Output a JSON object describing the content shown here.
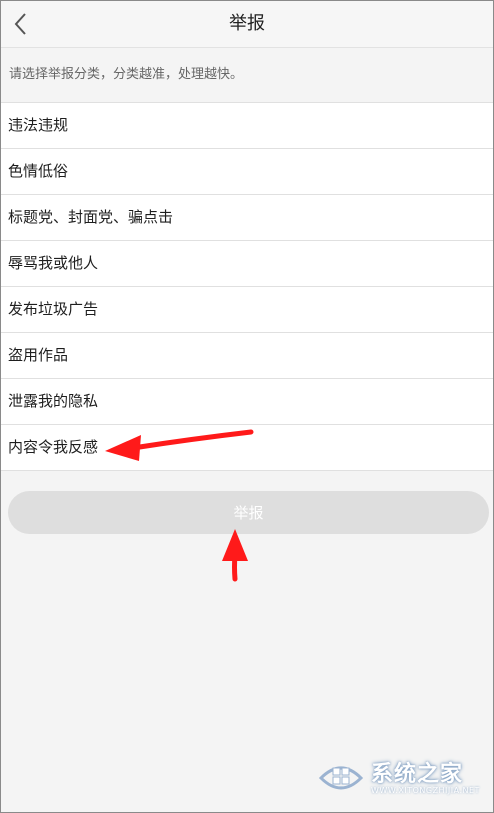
{
  "header": {
    "back_icon": "chevron-left-icon",
    "title": "举报"
  },
  "hint": "请选择举报分类，分类越准，处理越快。",
  "categories": [
    "违法违规",
    "色情低俗",
    "标题党、封面党、骗点击",
    "辱骂我或他人",
    "发布垃圾广告",
    "盗用作品",
    "泄露我的隐私",
    "内容令我反感"
  ],
  "submit_label": "举报",
  "watermark": {
    "brand": "系统之家",
    "url": "WWW.XITONGZHIJIA.NET"
  },
  "colors": {
    "annotation_arrow": "#ff1a1a",
    "button_disabled": "#dedede"
  }
}
